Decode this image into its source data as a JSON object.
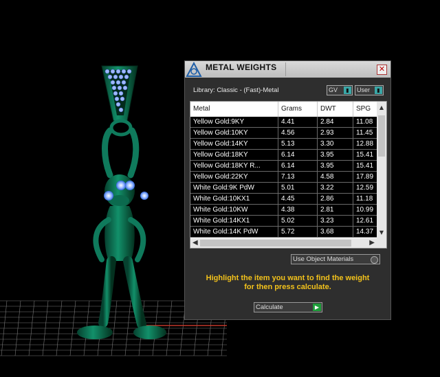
{
  "window": {
    "title": "METAL WEIGHTS",
    "close_glyph": "✕",
    "library_label": "Library: Classic - (Fast)-Metal",
    "unit_select": "GV",
    "user_select": "User",
    "use_object_materials": "Use Object Materials",
    "hint_line1": "Highlight the item you want to find the weight",
    "hint_line2": "for then press calculate.",
    "calculate_label": "Calculate"
  },
  "table": {
    "columns": [
      "Metal",
      "Grams",
      "DWT",
      "SPG"
    ],
    "rows": [
      [
        "Yellow Gold:9KY",
        "4.41",
        "2.84",
        "11.08"
      ],
      [
        "Yellow Gold:10KY",
        "4.56",
        "2.93",
        "11.45"
      ],
      [
        "Yellow Gold:14KY",
        "5.13",
        "3.30",
        "12.88"
      ],
      [
        "Yellow Gold:18KY",
        "6.14",
        "3.95",
        "15.41"
      ],
      [
        "Yellow Gold:18KY R...",
        "6.14",
        "3.95",
        "15.41"
      ],
      [
        "Yellow Gold:22KY",
        "7.13",
        "4.58",
        "17.89"
      ],
      [
        "White Gold:9K PdW",
        "5.01",
        "3.22",
        "12.59"
      ],
      [
        "White Gold:10KX1",
        "4.45",
        "2.86",
        "11.18"
      ],
      [
        "White Gold:10KW",
        "4.38",
        "2.81",
        "10.99"
      ],
      [
        "White Gold:14KX1",
        "5.02",
        "3.23",
        "12.61"
      ],
      [
        "White Gold:14K PdW",
        "5.72",
        "3.68",
        "14.37"
      ]
    ]
  },
  "icons": {
    "close": "close-icon",
    "logo": "app-logo-icon",
    "dropdown": "dropdown-arrow-icon",
    "play": "play-arrow-icon"
  },
  "colors": {
    "model": "#0f7a5c",
    "hint_text": "#f3c21b",
    "accent": "#3aa7a7",
    "calculate_knob": "#1e9e3a"
  }
}
